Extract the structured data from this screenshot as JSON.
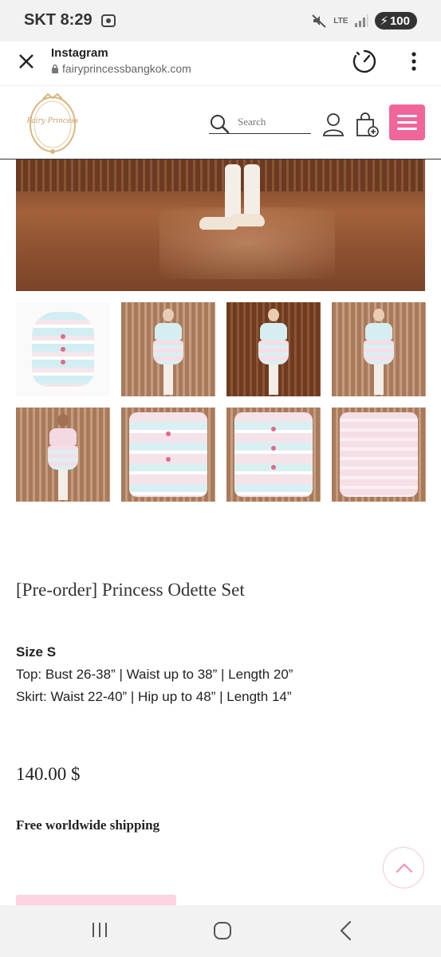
{
  "status_bar": {
    "carrier": "SKT",
    "time": "8:29",
    "network": "LTE",
    "battery": "100"
  },
  "browser": {
    "title": "Instagram",
    "url": "fairyprincessbangkok.com"
  },
  "header": {
    "logo_text": "Fairy Princess",
    "search_placeholder": "Search"
  },
  "product": {
    "title": "[Pre-order] Princess Odette Set",
    "size_heading": "Size S",
    "size_top": "Top: Bust 26-38” | Waist up to 38” | Length 20”",
    "size_skirt": "Skirt: Waist 22-40” | Hip up to 48” | Length 14”",
    "price": "140.00 $",
    "shipping": "Free worldwide shipping"
  },
  "colors": {
    "accent_pink": "#f0669a",
    "light_pink": "#fbd3e1"
  }
}
